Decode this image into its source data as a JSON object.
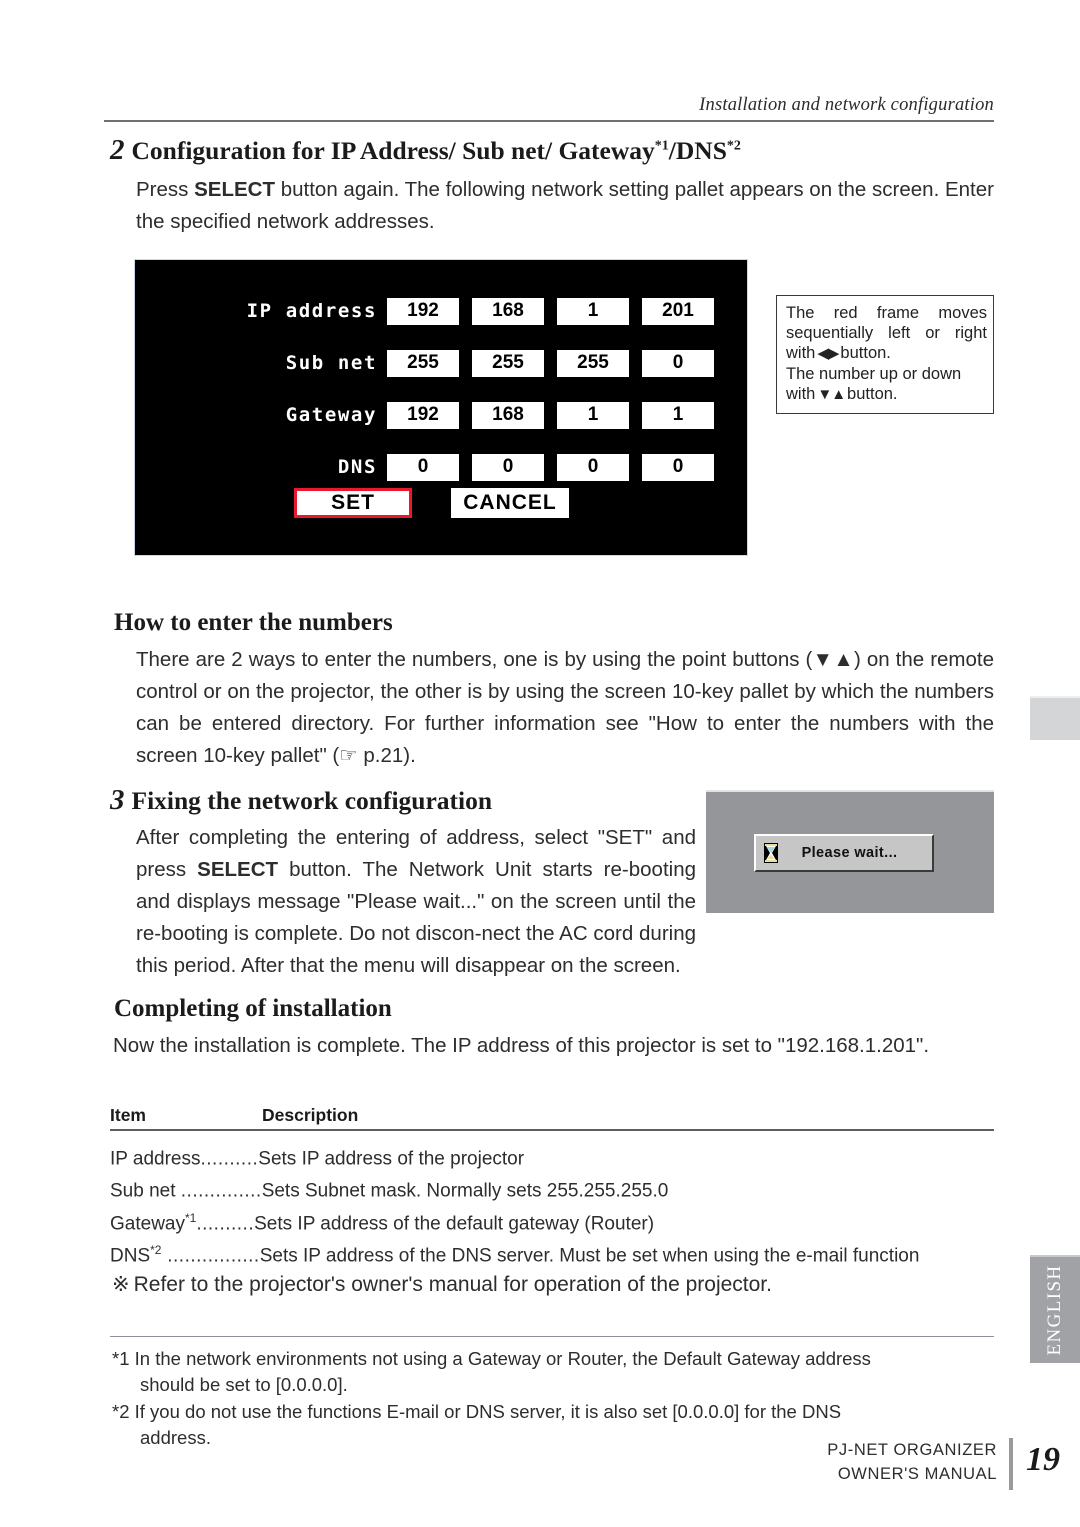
{
  "header": {
    "running_head": "Installation and network configuration"
  },
  "step2": {
    "number": "2",
    "title_part1": "Configuration for IP Address/ Sub net/ Gateway",
    "title_sup1": "*1",
    "title_part2": "/DNS",
    "title_sup2": "*2",
    "body_a": "Press ",
    "body_select": "SELECT",
    "body_b": " button again. The following network setting pallet appears on the screen. Enter the specified network addresses."
  },
  "pallet": {
    "rows": [
      {
        "label": "IP address",
        "octets": [
          "192",
          "168",
          "1",
          "201"
        ]
      },
      {
        "label": "Sub net",
        "octets": [
          "255",
          "255",
          "255",
          "0"
        ]
      },
      {
        "label": "Gateway",
        "octets": [
          "192",
          "168",
          "1",
          "1"
        ]
      },
      {
        "label": "DNS",
        "octets": [
          "0",
          "0",
          "0",
          "0"
        ]
      }
    ],
    "set_label": "SET",
    "cancel_label": "CANCEL",
    "focus_color": "#e8192c"
  },
  "callout": {
    "line1": "The red frame moves sequentially left or right with",
    "lr_glyph": "◀▶",
    "line1_end": "button.",
    "line2": "The number up or down with",
    "ud_glyph": "▼▲",
    "line2_end": "button."
  },
  "how_to": {
    "heading": "How to enter the numbers",
    "body_a": "There are 2 ways to enter the numbers, one is by using the point buttons (",
    "arrows": "▼▲",
    "body_b": ") on the remote control or on the projector, the other is by using the screen 10-key pallet by which the numbers can be entered directory. For further information see \"How to enter the numbers with the screen 10-key pallet\" (",
    "hand_glyph": "☞",
    "body_c": " p.21)."
  },
  "step3": {
    "number": "3",
    "title": "Fixing the network configuration",
    "body_a": "After completing the entering of address, select \"SET\" and press ",
    "body_select": "SELECT",
    "body_b": " button. The Network Unit starts re-booting and displays message \"Please wait...\" on the screen until the re-booting is complete. Do not discon-nect the AC cord during this period. After that the menu will disappear on the screen."
  },
  "wait_shot": {
    "icon": "hourglass-icon",
    "message": "Please wait..."
  },
  "completing": {
    "heading": "Completing of installation",
    "body": "Now the installation is complete. The IP address of this projector is set to \"192.168.1.201\"."
  },
  "table": {
    "columns": [
      "Item",
      "Description"
    ],
    "rows": [
      {
        "item": "IP address",
        "sup": "",
        "leader": "..........",
        "description": "Sets IP address of the projector"
      },
      {
        "item": "Sub net ",
        "sup": "",
        "leader": "..............",
        "description": "Sets Subnet mask. Normally sets 255.255.255.0"
      },
      {
        "item": "Gateway",
        "sup": "*1",
        "leader": "..........",
        "description": "Sets IP address of the default gateway (Router)"
      },
      {
        "item": "DNS",
        "sup": "*2",
        "leader": " ................",
        "description": "Sets IP address of the DNS server. Must be set when using the e-mail function"
      }
    ]
  },
  "note": {
    "symbol": "※",
    "text": "Refer to the projector's owner's manual for operation of the projector."
  },
  "footnotes": [
    {
      "marker": "*1",
      "text": "In the network environments not using a Gateway or Router, the Default Gateway address",
      "continuation": "should be set to [0.0.0.0]."
    },
    {
      "marker": "*2",
      "text": "If you do not use the functions E-mail or DNS server, it is also set [0.0.0.0] for the DNS",
      "continuation": "address."
    }
  ],
  "side_tab": {
    "label": "ENGLISH"
  },
  "footer": {
    "line1": "PJ-NET ORGANIZER",
    "line2": "OWNER'S MANUAL",
    "page_number": "19"
  }
}
